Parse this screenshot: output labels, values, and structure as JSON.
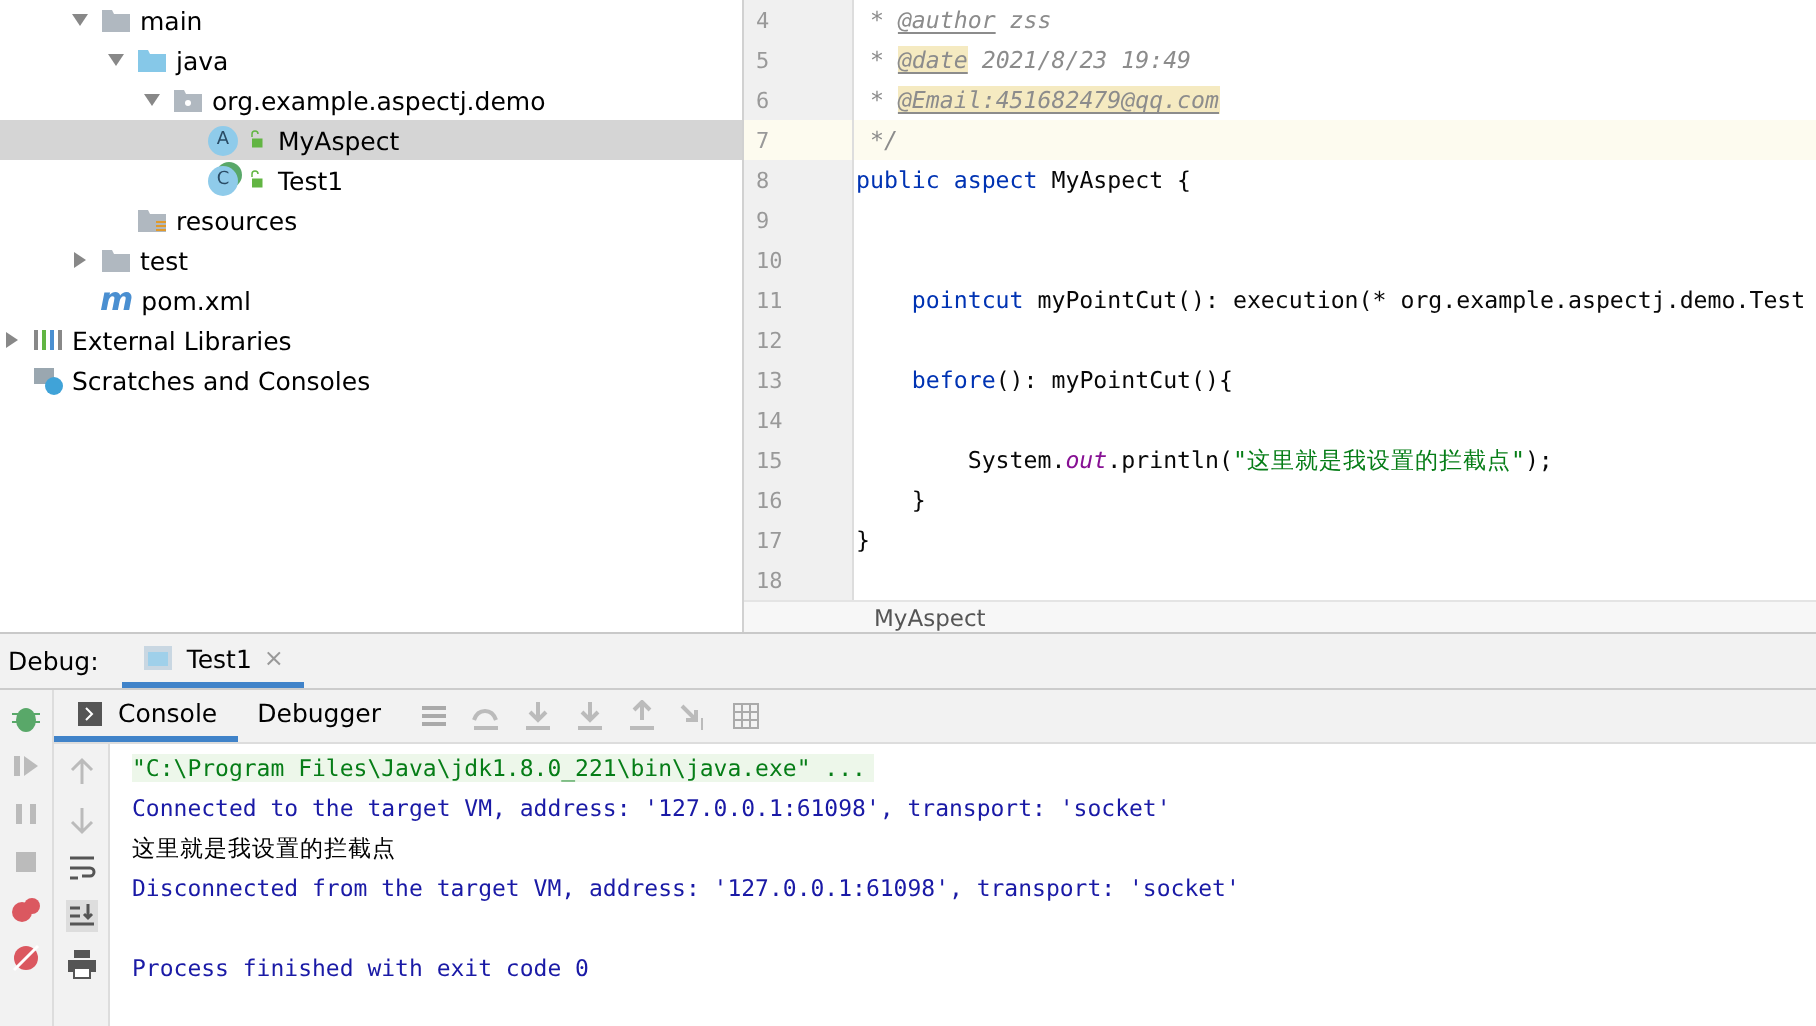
{
  "project_tree": [
    {
      "label": "main",
      "kind": "folder",
      "expanded": true,
      "selected": false,
      "children": [
        {
          "label": "java",
          "kind": "source-folder",
          "expanded": true,
          "selected": false,
          "children": [
            {
              "label": "org.example.aspectj.demo",
              "kind": "package",
              "expanded": true,
              "selected": false,
              "children": [
                {
                  "label": "MyAspect",
                  "kind": "aspect",
                  "badge": "A",
                  "selected": true
                },
                {
                  "label": "Test1",
                  "kind": "class",
                  "badge": "C",
                  "selected": false
                }
              ]
            }
          ]
        },
        {
          "label": "resources",
          "kind": "resources",
          "selected": false
        }
      ]
    },
    {
      "label": "test",
      "kind": "folder",
      "expanded": false,
      "selected": false
    },
    {
      "label": "pom.xml",
      "kind": "maven",
      "badge": "m",
      "selected": false
    },
    {
      "label": "External Libraries",
      "kind": "libraries",
      "expanded": false,
      "selected": false
    },
    {
      "label": "Scratches and Consoles",
      "kind": "scratches",
      "selected": false
    }
  ],
  "editor": {
    "lines": [
      {
        "number": "4",
        "current": false,
        "tokens": [
          {
            "kind": "comment",
            "text": " * "
          },
          {
            "kind": "tag",
            "text": "@author"
          },
          {
            "kind": "comment",
            "text": " zss"
          }
        ]
      },
      {
        "number": "5",
        "current": false,
        "tokens": [
          {
            "kind": "comment",
            "text": " * "
          },
          {
            "kind": "tag-hl",
            "text": "@date"
          },
          {
            "kind": "comment",
            "text": " 2021/8/23 19:49"
          }
        ]
      },
      {
        "number": "6",
        "current": false,
        "tokens": [
          {
            "kind": "comment",
            "text": " * "
          },
          {
            "kind": "tag-hl",
            "text": "@Email:451682479@qq.com"
          }
        ]
      },
      {
        "number": "7",
        "current": true,
        "tokens": [
          {
            "kind": "comment",
            "text": " */"
          }
        ]
      },
      {
        "number": "8",
        "current": false,
        "tokens": [
          {
            "kind": "keyword",
            "text": "public aspect"
          },
          {
            "kind": "plain",
            "text": " MyAspect {"
          }
        ]
      },
      {
        "number": "9",
        "current": false
      },
      {
        "number": "10",
        "current": false
      },
      {
        "number": "11",
        "current": false,
        "tokens": [
          {
            "kind": "keyword",
            "text": "    pointcut"
          },
          {
            "kind": "plain",
            "text": " myPointCut(): execution(* org.example.aspectj.demo.Test"
          }
        ]
      },
      {
        "number": "12",
        "current": false
      },
      {
        "number": "13",
        "current": false,
        "tokens": [
          {
            "kind": "keyword",
            "text": "    before"
          },
          {
            "kind": "plain",
            "text": "(): myPointCut(){"
          }
        ]
      },
      {
        "number": "14",
        "current": false
      },
      {
        "number": "15",
        "current": false,
        "tokens": [
          {
            "kind": "plain",
            "text": "        System."
          },
          {
            "kind": "static",
            "text": "out"
          },
          {
            "kind": "plain",
            "text": ".println("
          },
          {
            "kind": "string",
            "text": "\"这里就是我设置的拦截点\""
          },
          {
            "kind": "plain",
            "text": ");"
          }
        ]
      },
      {
        "number": "16",
        "current": false,
        "tokens": [
          {
            "kind": "plain",
            "text": "    }"
          }
        ]
      },
      {
        "number": "17",
        "current": false,
        "tokens": [
          {
            "kind": "plain",
            "text": "}"
          }
        ]
      },
      {
        "number": "18",
        "current": false
      }
    ],
    "breadcrumb": "MyAspect"
  },
  "debug": {
    "label": "Debug:",
    "tabs": [
      {
        "label": "Test1",
        "selected": true,
        "close": "×"
      }
    ],
    "subtabs": [
      {
        "label": "Console",
        "selected": true
      },
      {
        "label": "Debugger",
        "selected": false
      }
    ],
    "console": [
      {
        "kind": "command",
        "text": "\"C:\\Program Files\\Java\\jdk1.8.0_221\\bin\\java.exe\" ..."
      },
      {
        "kind": "info",
        "text": "Connected to the target VM, address: '127.0.0.1:61098', transport: 'socket'"
      },
      {
        "kind": "output",
        "text": "这里就是我设置的拦截点"
      },
      {
        "kind": "info",
        "text": "Disconnected from the target VM, address: '127.0.0.1:61098', transport: 'socket'"
      },
      {
        "kind": "blank"
      },
      {
        "kind": "info",
        "text": "Process finished with exit code 0"
      }
    ]
  }
}
